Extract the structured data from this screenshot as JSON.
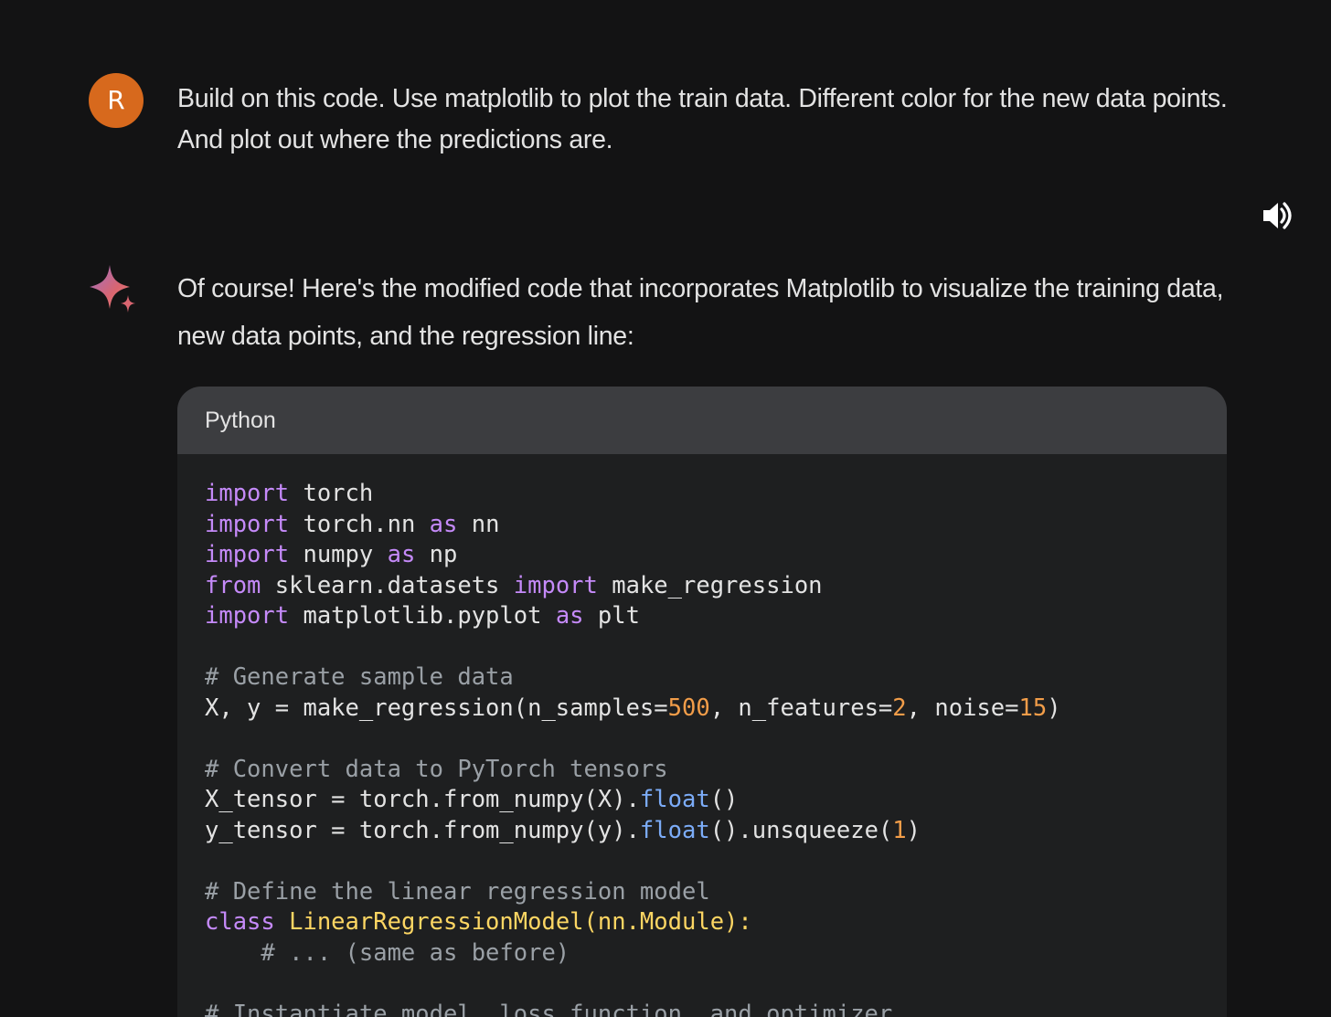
{
  "user": {
    "avatar_letter": "R",
    "message": "Build on this code. Use matplotlib to plot the train data. Different color for the new data points. And plot out where the predictions are."
  },
  "icons": {
    "speaker": "speaker-icon",
    "sparkle": "gemini-sparkle-icon",
    "avatar_color": "#d7691d"
  },
  "reply": {
    "text": "Of course! Here's the modified code that incorporates Matplotlib to visualize the training data, new data points, and the regression line:"
  },
  "code_block": {
    "language": "Python",
    "lines": [
      [
        {
          "t": "import",
          "c": "kw"
        },
        {
          "t": " torch"
        }
      ],
      [
        {
          "t": "import",
          "c": "kw"
        },
        {
          "t": " torch.nn "
        },
        {
          "t": "as",
          "c": "kw"
        },
        {
          "t": " nn"
        }
      ],
      [
        {
          "t": "import",
          "c": "kw"
        },
        {
          "t": " numpy "
        },
        {
          "t": "as",
          "c": "kw"
        },
        {
          "t": " np"
        }
      ],
      [
        {
          "t": "from",
          "c": "kw"
        },
        {
          "t": " sklearn.datasets "
        },
        {
          "t": "import",
          "c": "kw"
        },
        {
          "t": " make_regression"
        }
      ],
      [
        {
          "t": "import",
          "c": "kw"
        },
        {
          "t": " matplotlib.pyplot "
        },
        {
          "t": "as",
          "c": "kw"
        },
        {
          "t": " plt"
        }
      ],
      [],
      [
        {
          "t": "# Generate sample data",
          "c": "cm"
        }
      ],
      [
        {
          "t": "X, y = make_regression(n_samples="
        },
        {
          "t": "500",
          "c": "num"
        },
        {
          "t": ", n_features="
        },
        {
          "t": "2",
          "c": "num"
        },
        {
          "t": ", noise="
        },
        {
          "t": "15",
          "c": "num"
        },
        {
          "t": ")"
        }
      ],
      [],
      [
        {
          "t": "# Convert data to PyTorch tensors",
          "c": "cm"
        }
      ],
      [
        {
          "t": "X_tensor = torch.from_numpy(X)."
        },
        {
          "t": "float",
          "c": "fn"
        },
        {
          "t": "()"
        }
      ],
      [
        {
          "t": "y_tensor = torch.from_numpy(y)."
        },
        {
          "t": "float",
          "c": "fn"
        },
        {
          "t": "().unsqueeze("
        },
        {
          "t": "1",
          "c": "num"
        },
        {
          "t": ")"
        }
      ],
      [],
      [
        {
          "t": "# Define the linear regression model",
          "c": "cm"
        }
      ],
      [
        {
          "t": "class",
          "c": "kw"
        },
        {
          "t": " "
        },
        {
          "t": "LinearRegressionModel(nn.Module):",
          "c": "cls"
        }
      ],
      [
        {
          "t": "    # ... (same as before)",
          "c": "cm"
        }
      ],
      [],
      [
        {
          "t": "# Instantiate model, loss function, and optimizer",
          "c": "cm"
        }
      ]
    ]
  }
}
